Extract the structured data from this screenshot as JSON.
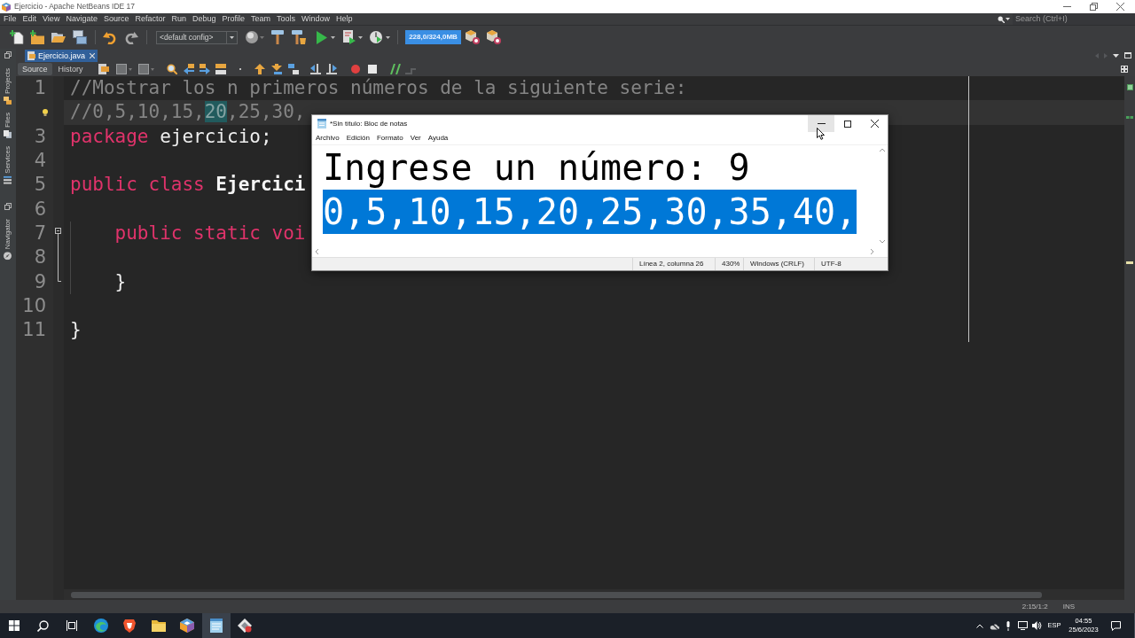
{
  "window": {
    "title": "Ejercicio - Apache NetBeans IDE 17"
  },
  "menu": [
    "File",
    "Edit",
    "View",
    "Navigate",
    "Source",
    "Refactor",
    "Run",
    "Debug",
    "Profile",
    "Team",
    "Tools",
    "Window",
    "Help"
  ],
  "search": {
    "placeholder": "Search (Ctrl+I)"
  },
  "toolbar": {
    "config": "<default config>",
    "memory": "228,0/324,0MB"
  },
  "side_panel_groups": [
    {
      "panels": [
        "Projects",
        "Files",
        "Services"
      ]
    },
    {
      "panels": [
        "Navigator"
      ]
    }
  ],
  "editor_tabs": [
    {
      "label": "Ejercicio.java",
      "selected": true
    }
  ],
  "view_switch": [
    {
      "label": "Source",
      "selected": true
    },
    {
      "label": "History",
      "selected": false
    }
  ],
  "code_lines": [
    {
      "number": "1",
      "hint": false,
      "current": false,
      "fold_start": false,
      "fold_body": false,
      "tokens": [
        {
          "text": "//Mostrar los n primeros números de la siguiente serie:",
          "kind": "comment"
        }
      ]
    },
    {
      "hint": true,
      "current": true,
      "fold_start": false,
      "fold_body": false,
      "tokens": [
        {
          "text": "//0,5,10,15,",
          "kind": "comment"
        },
        {
          "text": "20",
          "kind": "match"
        },
        {
          "text": ",25,30,",
          "kind": "comment"
        }
      ]
    },
    {
      "number": "3",
      "hint": false,
      "current": false,
      "fold_start": false,
      "fold_body": false,
      "tokens": [
        {
          "text": "package",
          "kind": "keyword"
        },
        {
          "text": " ejercicio;",
          "kind": "plain"
        }
      ]
    },
    {
      "number": "4",
      "hint": false,
      "current": false,
      "fold_start": false,
      "fold_body": false
    },
    {
      "number": "5",
      "hint": false,
      "current": false,
      "fold_start": false,
      "fold_body": false,
      "tokens": [
        {
          "text": "public class",
          "kind": "keyword"
        },
        {
          "text": " Ejercici",
          "kind": "name"
        }
      ]
    },
    {
      "number": "6",
      "hint": false,
      "current": false,
      "fold_start": false,
      "fold_body": false
    },
    {
      "number": "7",
      "hint": false,
      "current": false,
      "fold_start": true,
      "fold_body": false,
      "tokens": [
        {
          "text": "    public static voi",
          "kind": "keyword"
        }
      ]
    },
    {
      "number": "8",
      "hint": false,
      "current": false,
      "fold_start": false,
      "fold_body": true
    },
    {
      "number": "9",
      "hint": false,
      "current": false,
      "fold_start": false,
      "fold_body": true,
      "tokens": [
        {
          "text": "    }",
          "kind": "plain"
        }
      ]
    },
    {
      "number": "10",
      "hint": false,
      "current": false,
      "fold_start": false,
      "fold_body": false
    },
    {
      "number": "11",
      "hint": false,
      "current": false,
      "fold_start": false,
      "fold_body": false,
      "tokens": [
        {
          "text": "}",
          "kind": "plain"
        }
      ]
    }
  ],
  "status_bar": {
    "position": "2:15/1:2",
    "mode": "INS"
  },
  "notepad": {
    "title": "*Sin título: Bloc de notas",
    "window_buttons": [
      {
        "hovered": true
      },
      {
        "hovered": false
      },
      {
        "hovered": false
      }
    ],
    "menu": [
      "Archivo",
      "Edición",
      "Formato",
      "Ver",
      "Ayuda"
    ],
    "lines": [
      {
        "text": "Ingrese un número: 9",
        "selected": false
      },
      {
        "text": "0,5,10,15,20,25,30,35,40,",
        "selected": true
      }
    ],
    "status": [
      "Línea 2, columna 26",
      "430%",
      "Windows (CRLF)",
      "UTF-8"
    ]
  },
  "taskbar": {
    "apps": [
      {
        "selected": false
      },
      {
        "selected": false
      },
      {
        "selected": false
      },
      {
        "selected": false
      },
      {
        "selected": true
      },
      {
        "selected": false
      }
    ],
    "language": "ESP",
    "time": "04:55",
    "date": "25/6/2023"
  }
}
